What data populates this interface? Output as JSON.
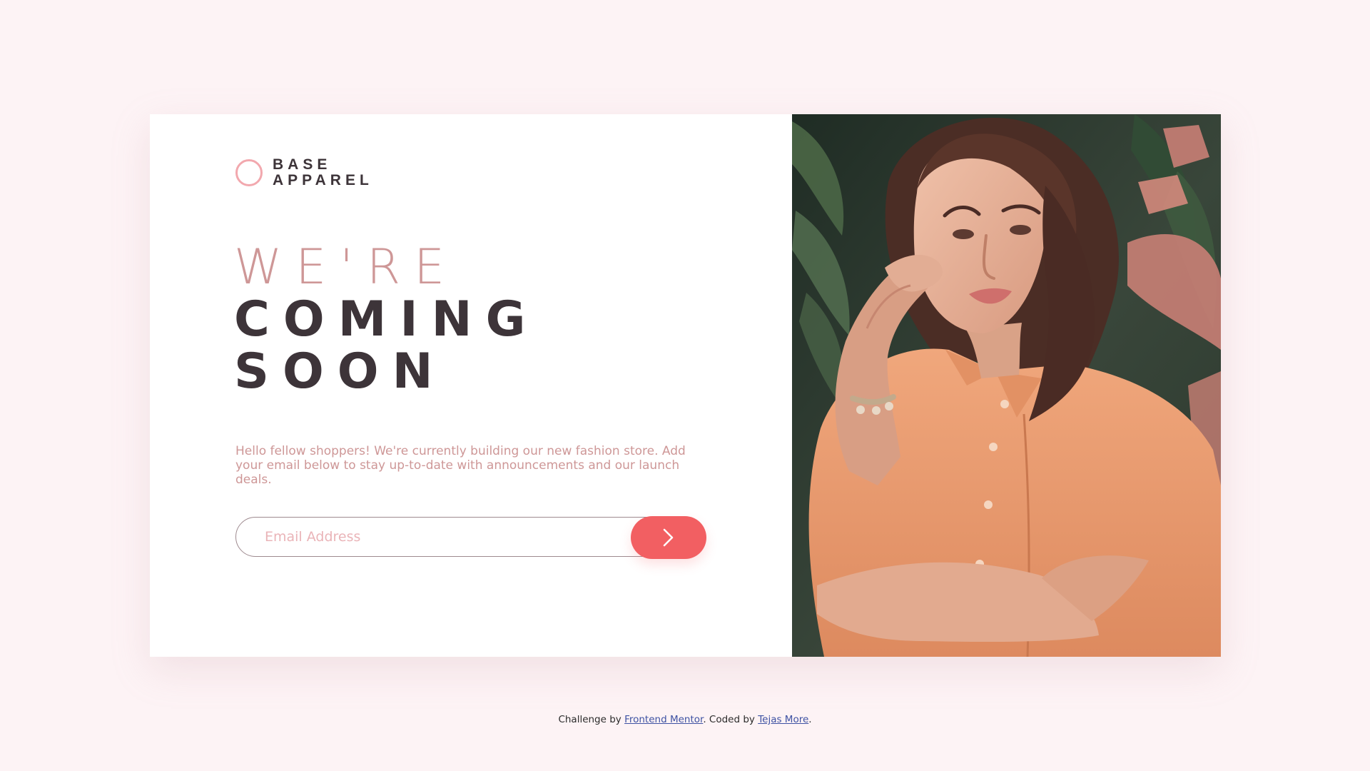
{
  "brand": {
    "line1": "BASE",
    "line2": "APPAREL",
    "accent": "#f2a8ae",
    "logo_icon": "ring-icon"
  },
  "headline": {
    "line1": "WE'RE",
    "line2": "COMING",
    "line3": "SOON"
  },
  "intro": "Hello fellow shoppers! We're currently building our new fashion store. Add your email below to stay up-to-date with announcements and our launch deals.",
  "form": {
    "email_placeholder": "Email Address",
    "email_value": "",
    "submit_icon": "chevron-right-icon",
    "submit_color": "#f25f62"
  },
  "hero": {
    "image_icon": "model-photo"
  },
  "footer": {
    "prefix": "Challenge by",
    "link1": "Frontend Mentor",
    "middle": ". Coded by",
    "link2": "Tejas More",
    "suffix": "."
  },
  "colors": {
    "background": "#fdf3f5",
    "primary_text": "#3d3439",
    "desaturated_red": "#ce9797",
    "soft_red": "#f25f62"
  }
}
